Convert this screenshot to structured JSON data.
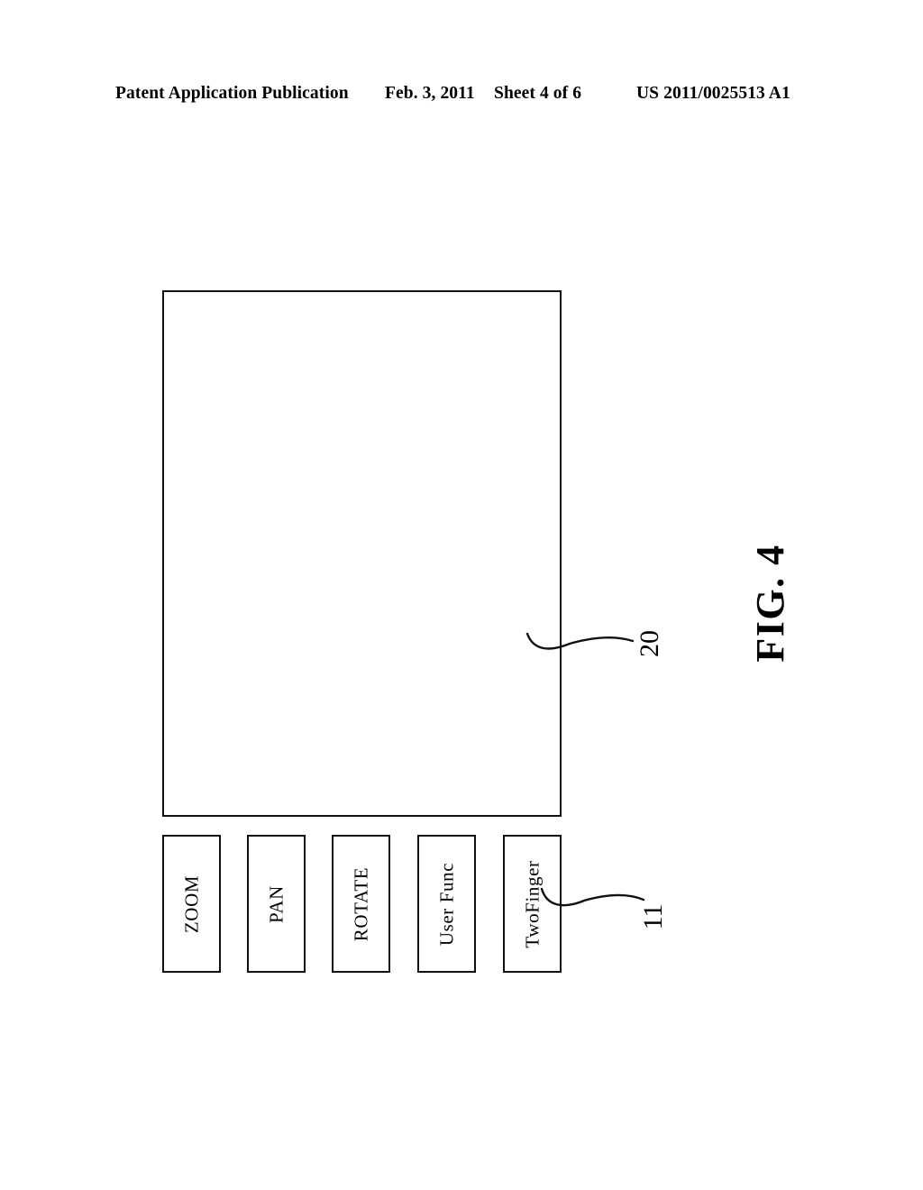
{
  "header": {
    "publication": "Patent Application Publication",
    "date": "Feb. 3, 2011",
    "sheet": "Sheet 4 of 6",
    "patent_number": "US 2011/0025513 A1"
  },
  "figure": {
    "caption": "FIG. 4",
    "display_ref": "20",
    "buttons_ref": "11",
    "buttons": [
      {
        "label": "ZOOM"
      },
      {
        "label": "PAN"
      },
      {
        "label": "ROTATE"
      },
      {
        "label": "User Func"
      },
      {
        "label": "TwoFinger"
      }
    ]
  },
  "colors": {
    "ink": "#111111",
    "paper": "#ffffff"
  }
}
